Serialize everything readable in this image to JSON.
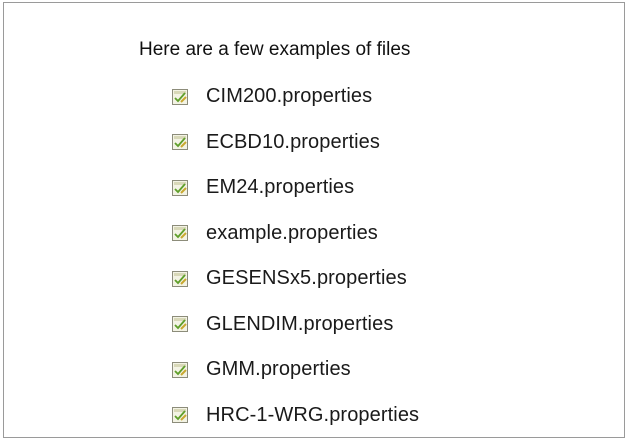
{
  "heading": "Here are a few examples of files",
  "icon_name": "properties-file-icon",
  "files": [
    "CIM200.properties",
    "ECBD10.properties",
    "EM24.properties",
    "example.properties",
    "GESENSx5.properties",
    "GLENDIM.properties",
    "GMM.properties",
    "HRC-1-WRG.properties"
  ]
}
